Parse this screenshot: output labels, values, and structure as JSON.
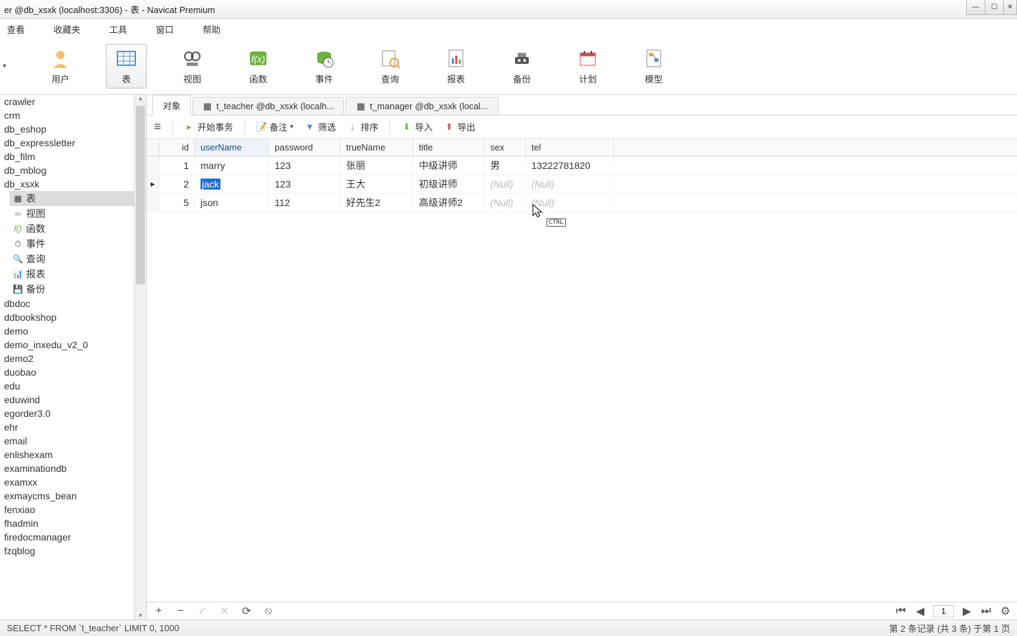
{
  "window": {
    "title": "er @db_xsxk (localhost:3306) - 表 - Navicat Premium"
  },
  "menu": {
    "items": [
      "查看",
      "收藏夹",
      "工具",
      "窗口",
      "帮助"
    ]
  },
  "toolbar": {
    "user": "用户",
    "table": "表",
    "view": "视图",
    "function": "函数",
    "event": "事件",
    "query": "查询",
    "report": "报表",
    "backup": "备份",
    "schedule": "计划",
    "model": "模型"
  },
  "sidebar": {
    "databases": [
      "crawler",
      "crm",
      "db_eshop",
      "db_expressletter",
      "db_film",
      "db_mblog",
      "db_xsxk"
    ],
    "children": [
      {
        "icon": "table",
        "label": "表"
      },
      {
        "icon": "view",
        "label": "视图"
      },
      {
        "icon": "fx",
        "label": "函数"
      },
      {
        "icon": "event",
        "label": "事件"
      },
      {
        "icon": "query",
        "label": "查询"
      },
      {
        "icon": "report",
        "label": "报表"
      },
      {
        "icon": "backup",
        "label": "备份"
      }
    ],
    "databases2": [
      "dbdoc",
      "ddbookshop",
      "demo",
      "demo_inxedu_v2_0",
      "demo2",
      "duobao",
      "edu",
      "eduwind",
      "egorder3.0",
      "ehr",
      "email",
      "enlishexam",
      "examinationdb",
      "examxx",
      "exmaycms_bean",
      "fenxiao",
      "fhadmin",
      "firedocmanager",
      "fzqblog"
    ]
  },
  "tabs": {
    "items": [
      {
        "label": "对象",
        "active": true
      },
      {
        "label": "t_teacher @db_xsxk (localh...",
        "active": false
      },
      {
        "label": "t_manager @db_xsxk (local...",
        "active": false
      }
    ]
  },
  "subbar": {
    "hamburger": "≡",
    "begin": "开始事务",
    "note": "备注",
    "filter": "筛选",
    "sort": "排序",
    "import": "导入",
    "export": "导出"
  },
  "table": {
    "columns": [
      "id",
      "userName",
      "password",
      "trueName",
      "title",
      "sex",
      "tel"
    ],
    "rows": [
      {
        "id": "1",
        "userName": "marry",
        "password": "123",
        "trueName": "张丽",
        "title": "中级讲师",
        "sex": "男",
        "tel": "13222781820"
      },
      {
        "id": "2",
        "userName": "jack",
        "password": "123",
        "trueName": "王大",
        "title": "初级讲师",
        "sex": "(Null)",
        "tel": "(Null)"
      },
      {
        "id": "5",
        "userName": "json",
        "password": "112",
        "trueName": "好先生2",
        "title": "高级讲师2",
        "sex": "(Null)",
        "tel": "(Null)"
      }
    ],
    "selectedRow": 1,
    "selectedCell": "userName"
  },
  "cursor_badge": "CTRL",
  "pager": {
    "page": "1"
  },
  "status": {
    "left": "SELECT * FROM `t_teacher` LIMIT 0, 1000",
    "right": "第 2 条记录 (共 3 条) 于第 1 页"
  }
}
